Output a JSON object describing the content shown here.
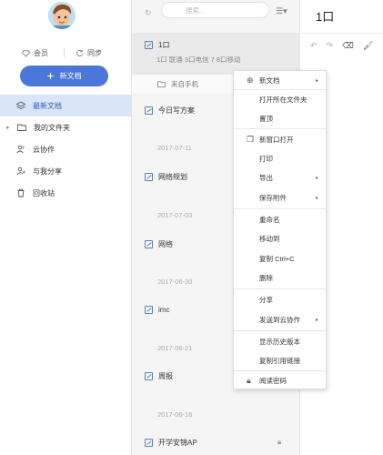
{
  "sidebar": {
    "vip_label": "会员",
    "sync_label": "同步",
    "new_doc_label": "新文档",
    "nav": [
      {
        "label": "最新文档",
        "icon": "layers-icon"
      },
      {
        "label": "我的文件夹",
        "icon": "folder-icon"
      },
      {
        "label": "云协作",
        "icon": "users-icon"
      },
      {
        "label": "与我分享",
        "icon": "share-user-icon"
      },
      {
        "label": "回收站",
        "icon": "trash-icon"
      }
    ]
  },
  "list": {
    "search_placeholder": "搜索...",
    "items": [
      {
        "title": "1口",
        "subtitle": "1口 联通 3口电信 7 8口移动"
      },
      {
        "title": "今日写方案"
      },
      {
        "title": "网络规划"
      },
      {
        "title": "网络"
      },
      {
        "title": "imc"
      },
      {
        "title": "周报"
      },
      {
        "title": "开学安锦AP"
      }
    ],
    "folder_row": "来自手机",
    "dates": [
      "2017-07-11",
      "2017-07-03",
      "2017-06-30",
      "2017-06-21",
      "2017-06-16"
    ]
  },
  "right": {
    "title": "1口"
  },
  "menu": {
    "items": [
      "新文档",
      "打开所在文件夹",
      "置顶",
      "新窗口打开",
      "打印",
      "导出",
      "保存附件",
      "重命名",
      "移动到",
      "复制 Ctrl+C",
      "删除",
      "分享",
      "发送到云协作",
      "显示历史版本",
      "复制引用链接",
      "阅读密码"
    ]
  },
  "colors": {
    "accent": "#4a77d9",
    "active_nav_bg": "#dbe5f8"
  }
}
